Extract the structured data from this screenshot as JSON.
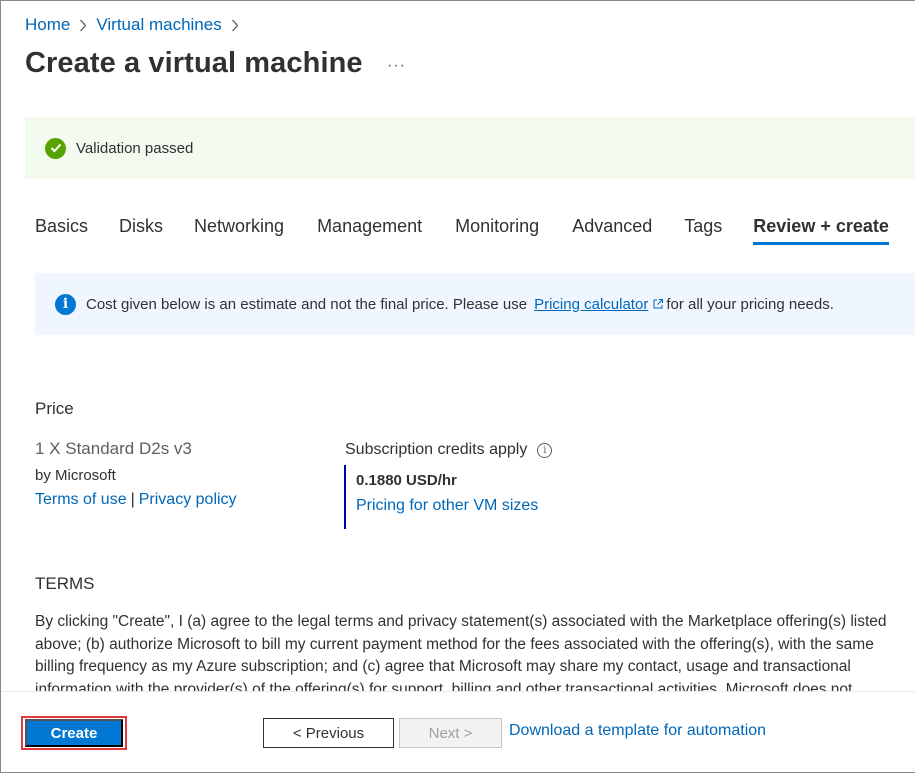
{
  "breadcrumb": {
    "items": [
      "Home",
      "Virtual machines"
    ]
  },
  "page": {
    "title": "Create a virtual machine",
    "more": "···"
  },
  "validation": {
    "message": "Validation passed",
    "icon": "check-circle-icon",
    "color": "#57a300"
  },
  "tabs": [
    {
      "label": "Basics"
    },
    {
      "label": "Disks"
    },
    {
      "label": "Networking"
    },
    {
      "label": "Management"
    },
    {
      "label": "Monitoring"
    },
    {
      "label": "Advanced"
    },
    {
      "label": "Tags"
    },
    {
      "label": "Review + create",
      "active": true
    }
  ],
  "info_banner": {
    "text_before": "Cost given below is an estimate and not the final price. Please use",
    "link": "Pricing calculator",
    "text_after": "for all your pricing needs.",
    "icon": "info-icon"
  },
  "price": {
    "section_title": "Price",
    "product_name": "1 X Standard D2s v3",
    "by": "by Microsoft",
    "terms_link": "Terms of use",
    "separator": "|",
    "privacy_link": "Privacy policy",
    "credits_label": "Subscription credits apply",
    "value": "0.1880 USD/hr",
    "other_sizes_link": "Pricing for other VM sizes"
  },
  "terms": {
    "section_title": "TERMS",
    "lines": [
      "By clicking \"Create\", I (a) agree to the legal terms and privacy statement(s) associated with the Marketplace offering(s) listed",
      "above; (b) authorize Microsoft to bill my current payment method for the fees associated with the offering(s), with the same",
      "billing frequency as my Azure subscription; and (c) agree that Microsoft may share my contact, usage and transactional",
      "information with the provider(s) of the offering(s) for support, billing and other transactional activities. Microsoft does not"
    ]
  },
  "footer": {
    "create_label": "Create",
    "previous_label": "< Previous",
    "next_label": "Next >",
    "download_link": "Download a template for automation"
  },
  "colors": {
    "accent": "#0078d4",
    "link": "#0067b8",
    "success": "#57a300",
    "highlight_border": "#e03a3e"
  }
}
